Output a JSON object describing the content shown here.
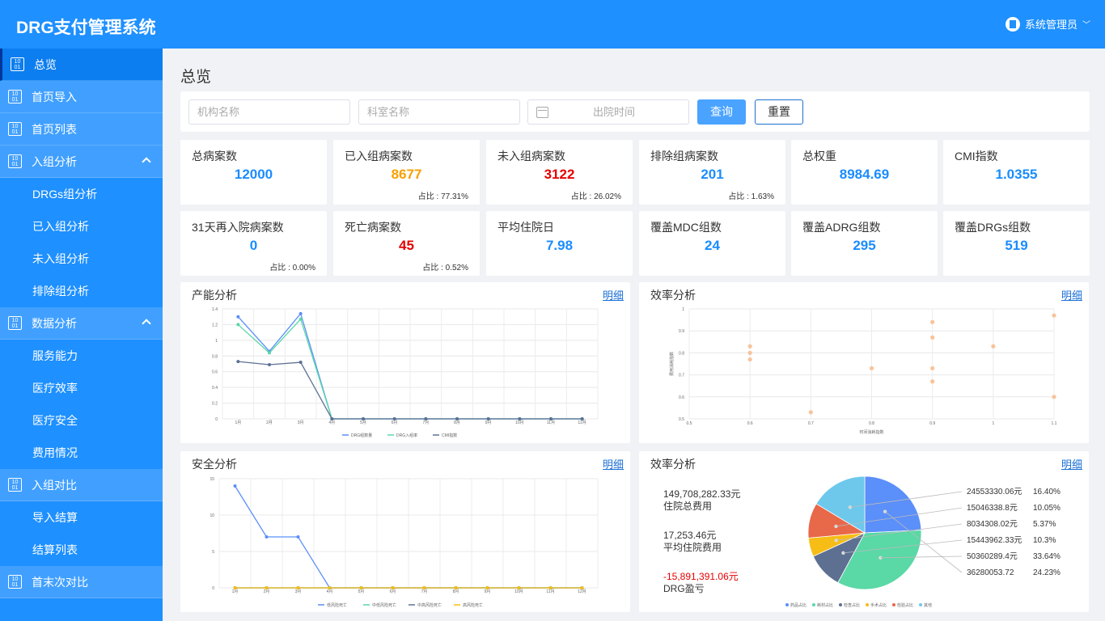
{
  "app": {
    "title": "DRG支付管理系统",
    "user": "系统管理员"
  },
  "sidebar": {
    "items": [
      {
        "label": "总览",
        "type": "item",
        "active": true
      },
      {
        "label": "首页导入",
        "type": "item"
      },
      {
        "label": "首页列表",
        "type": "item"
      },
      {
        "label": "入组分析",
        "type": "group",
        "expanded": true
      },
      {
        "label": "DRGs组分析",
        "type": "sub"
      },
      {
        "label": "已入组分析",
        "type": "sub"
      },
      {
        "label": "未入组分析",
        "type": "sub"
      },
      {
        "label": "排除组分析",
        "type": "sub"
      },
      {
        "label": "数据分析",
        "type": "group",
        "expanded": true
      },
      {
        "label": "服务能力",
        "type": "sub"
      },
      {
        "label": "医疗效率",
        "type": "sub"
      },
      {
        "label": "医疗安全",
        "type": "sub"
      },
      {
        "label": "费用情况",
        "type": "sub"
      },
      {
        "label": "入组对比",
        "type": "item"
      },
      {
        "label": "导入结算",
        "type": "sub"
      },
      {
        "label": "结算列表",
        "type": "sub"
      },
      {
        "label": "首末次对比",
        "type": "item"
      }
    ]
  },
  "page": {
    "title": "总览"
  },
  "filters": {
    "org_placeholder": "机构名称",
    "dept_placeholder": "科室名称",
    "date_placeholder": "出院时间",
    "query_label": "查询",
    "reset_label": "重置"
  },
  "stats": [
    {
      "label": "总病案数",
      "value": "12000",
      "color": "blue",
      "pct": ""
    },
    {
      "label": "已入组病案数",
      "value": "8677",
      "color": "orange",
      "pct": "占比 : 77.31%"
    },
    {
      "label": "未入组病案数",
      "value": "3122",
      "color": "red",
      "pct": "占比 : 26.02%"
    },
    {
      "label": "排除组病案数",
      "value": "201",
      "color": "blue",
      "pct": "占比 : 1.63%"
    },
    {
      "label": "总权重",
      "value": "8984.69",
      "color": "blue",
      "pct": ""
    },
    {
      "label": "CMI指数",
      "value": "1.0355",
      "color": "blue",
      "pct": ""
    },
    {
      "label": "31天再入院病案数",
      "value": "0",
      "color": "blue",
      "pct": "占比 : 0.00%"
    },
    {
      "label": "死亡病案数",
      "value": "45",
      "color": "red",
      "pct": "占比 : 0.52%"
    },
    {
      "label": "平均住院日",
      "value": "7.98",
      "color": "blue",
      "pct": ""
    },
    {
      "label": "覆盖MDC组数",
      "value": "24",
      "color": "blue",
      "pct": ""
    },
    {
      "label": "覆盖ADRG组数",
      "value": "295",
      "color": "blue",
      "pct": ""
    },
    {
      "label": "覆盖DRGs组数",
      "value": "519",
      "color": "blue",
      "pct": ""
    }
  ],
  "panels": {
    "capacity": {
      "title": "产能分析",
      "detail": "明细"
    },
    "efficiency": {
      "title": "效率分析",
      "detail": "明细"
    },
    "safety": {
      "title": "安全分析",
      "detail": "明细"
    },
    "cost": {
      "title": "效率分析",
      "detail": "明细"
    }
  },
  "chart_data": [
    {
      "type": "line",
      "ylim": [
        0,
        1.4
      ],
      "yticks": [
        "0",
        "0.2",
        "0.4",
        "0.6",
        "0.8",
        "1",
        "1.2",
        "1.4"
      ],
      "categories": [
        "1月",
        "2月",
        "3月",
        "4月",
        "5月",
        "6月",
        "7月",
        "8月",
        "9月",
        "10月",
        "11月",
        "12月"
      ],
      "series": [
        {
          "name": "DRG组数量",
          "color": "#5b8ff9",
          "values": [
            1.3,
            0.86,
            1.34,
            0,
            0,
            0,
            0,
            0,
            0,
            0,
            0,
            0
          ]
        },
        {
          "name": "DRG入组率",
          "color": "#5ad8a6",
          "values": [
            1.2,
            0.84,
            1.27,
            0,
            0,
            0,
            0,
            0,
            0,
            0,
            0,
            0
          ]
        },
        {
          "name": "CMI指数",
          "color": "#5d7092",
          "values": [
            0.73,
            0.69,
            0.72,
            0,
            0,
            0,
            0,
            0,
            0,
            0,
            0,
            0
          ]
        }
      ]
    },
    {
      "type": "scatter",
      "xlabel": "时间消耗指数",
      "ylabel": "费用消耗指数",
      "xlim": [
        0.5,
        1.1
      ],
      "ylim": [
        0.5,
        1.0
      ],
      "xticks": [
        "0.5",
        "0.6",
        "0.7",
        "0.8",
        "0.9",
        "1",
        "1.1"
      ],
      "yticks": [
        "0.5",
        "0.6",
        "0.7",
        "0.8",
        "0.9",
        "1"
      ],
      "points": [
        [
          0.6,
          0.83
        ],
        [
          0.6,
          0.8
        ],
        [
          0.6,
          0.77
        ],
        [
          0.7,
          0.53
        ],
        [
          0.8,
          0.73
        ],
        [
          0.9,
          0.94
        ],
        [
          0.9,
          0.87
        ],
        [
          0.9,
          0.73
        ],
        [
          0.9,
          0.67
        ],
        [
          1.0,
          0.83
        ],
        [
          1.1,
          0.97
        ],
        [
          1.1,
          0.6
        ]
      ]
    },
    {
      "type": "line",
      "ylim": [
        0,
        15
      ],
      "yticks": [
        "0",
        "5",
        "10",
        "15"
      ],
      "categories": [
        "1月",
        "2月",
        "3月",
        "4月",
        "5月",
        "6月",
        "7月",
        "8月",
        "9月",
        "10月",
        "11月",
        "12月"
      ],
      "series": [
        {
          "name": "低风险死亡",
          "color": "#5b8ff9",
          "values": [
            14,
            7,
            7,
            0,
            0,
            0,
            0,
            0,
            0,
            0,
            0,
            0
          ]
        },
        {
          "name": "中低风险死亡",
          "color": "#5ad8a6",
          "values": [
            0,
            0,
            0,
            0,
            0,
            0,
            0,
            0,
            0,
            0,
            0,
            0
          ]
        },
        {
          "name": "中高风险死亡",
          "color": "#5d7092",
          "values": [
            0,
            0,
            0,
            0,
            0,
            0,
            0,
            0,
            0,
            0,
            0,
            0
          ]
        },
        {
          "name": "高风险死亡",
          "color": "#f6bd16",
          "values": [
            0,
            0,
            0,
            0,
            0,
            0,
            0,
            0,
            0,
            0,
            0,
            0
          ]
        }
      ]
    },
    {
      "type": "pie",
      "summary": [
        {
          "value": "149,708,282.33元",
          "label": "住院总费用",
          "negative": false
        },
        {
          "value": "17,253.46元",
          "label": "平均住院费用",
          "negative": false
        },
        {
          "value": "-15,891,391.06元",
          "label": "DRG盈亏",
          "negative": true
        }
      ],
      "slices": [
        {
          "name": "药品占比",
          "value": 36280053.72,
          "label": "36280053.72",
          "pct": "24.23%",
          "color": "#5b8ff9"
        },
        {
          "name": "耗材占比",
          "value": 50360289.4,
          "label": "50360289.4元",
          "pct": "33.64%",
          "color": "#5ad8a6"
        },
        {
          "name": "检查占比",
          "value": 15443962.33,
          "label": "15443962.33元",
          "pct": "10.3%",
          "color": "#5d7092"
        },
        {
          "name": "手术占比",
          "value": 8034308.02,
          "label": "8034308.02元",
          "pct": "5.37%",
          "color": "#f6bd16"
        },
        {
          "name": "检验占比",
          "value": 15046338.8,
          "label": "15046338.8元",
          "pct": "10.05%",
          "color": "#e8684a"
        },
        {
          "name": "其他",
          "value": 24553330.06,
          "label": "24553330.06元",
          "pct": "16.40%",
          "color": "#6dc8ec"
        }
      ]
    }
  ]
}
